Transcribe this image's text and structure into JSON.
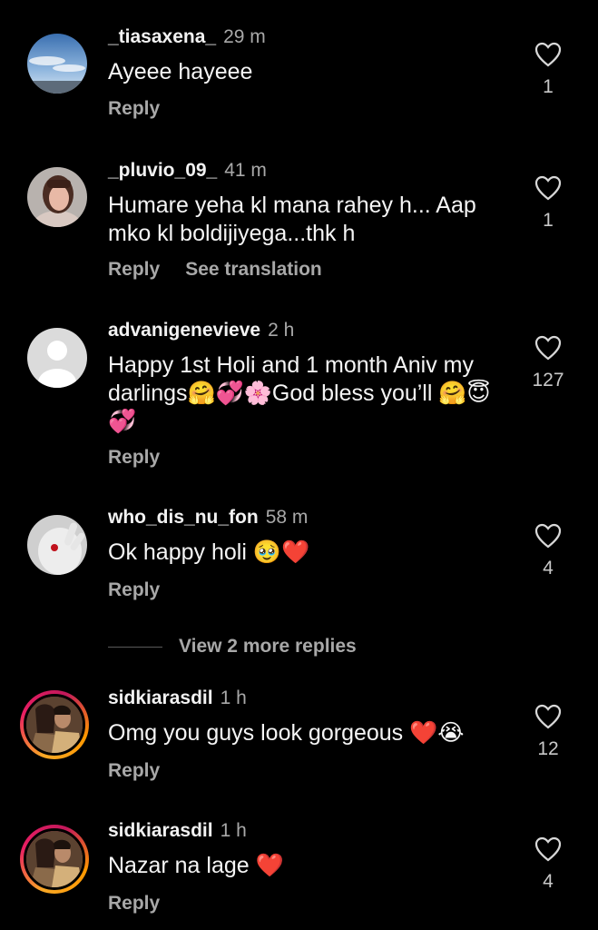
{
  "comments": [
    {
      "username": "_tiasaxena_",
      "time": "29 m",
      "text": "Ayeee hayeee",
      "reply_label": "Reply",
      "likes": "1",
      "avatar": "sky-clouds-photo"
    },
    {
      "username": "_pluvio_09_",
      "time": "41 m",
      "text": "Humare yeha kl mana rahey h... Aap mko kl boldijiyega...thk h",
      "reply_label": "Reply",
      "translation_label": "See translation",
      "likes": "1",
      "avatar": "girl-portrait-photo"
    },
    {
      "username": "advanigenevieve",
      "time": "2 h",
      "text": "Happy 1st Holi and 1 month Aniv my darlings🤗💞🌸God bless you’ll 🤗😇 💞",
      "reply_label": "Reply",
      "likes": "127",
      "avatar": "default-user-avatar"
    },
    {
      "username": "who_dis_nu_fon",
      "time": "58 m",
      "text": "Ok happy holi 🥹❤️",
      "reply_label": "Reply",
      "likes": "4",
      "avatar": "hand-photo"
    },
    {
      "username": "sidkiarasdil",
      "time": "1 h",
      "text": "Omg you guys look gorgeous ❤️😭",
      "reply_label": "Reply",
      "likes": "12",
      "avatar": "couple-photo-story-ring"
    },
    {
      "username": "sidkiarasdil",
      "time": "1 h",
      "text": "Nazar na lage ❤️",
      "reply_label": "Reply",
      "likes": "4",
      "avatar": "couple-photo-story-ring"
    }
  ],
  "view_more_replies": "View 2 more replies",
  "colors": {
    "background": "#000000",
    "text": "#f5f5f5",
    "secondary": "#a8a8a8",
    "heart": "#e0202e",
    "story_ring": "#e91e63"
  }
}
